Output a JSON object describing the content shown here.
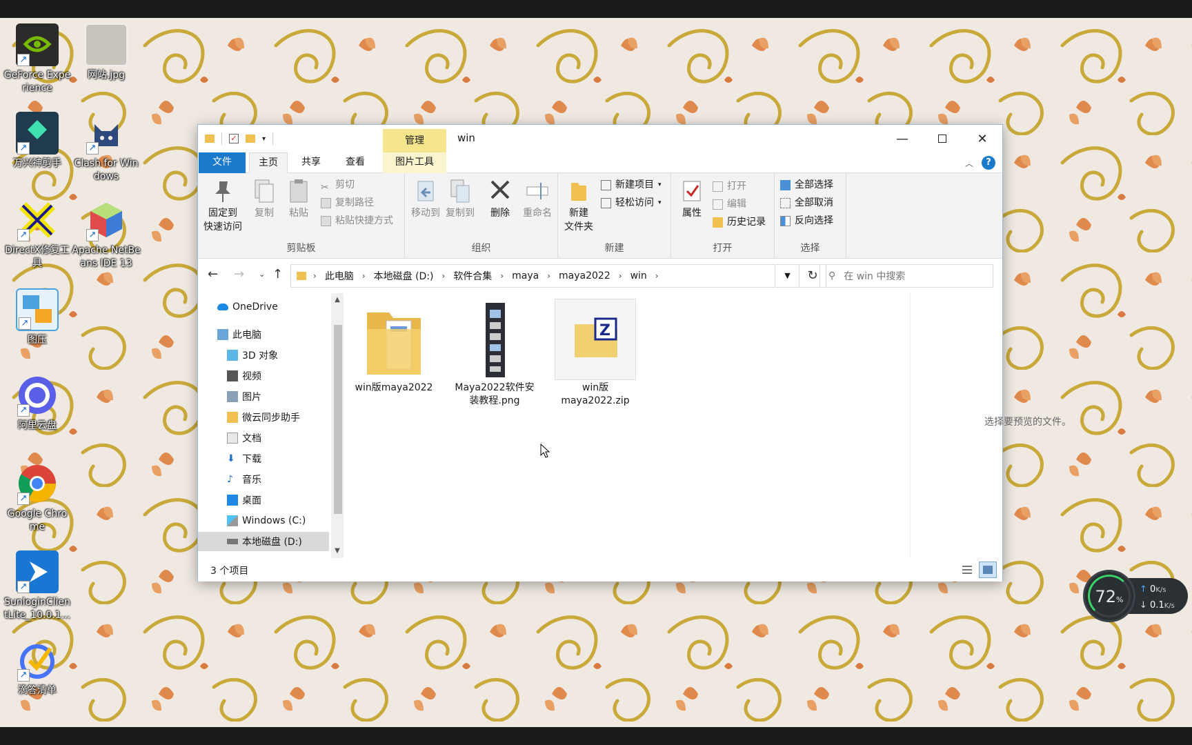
{
  "desktop": {
    "icons": [
      {
        "label": "GeForce Experience",
        "icon": "nvidia-icon",
        "color": "#2b2b2b"
      },
      {
        "label": "网站.jpg",
        "icon": "image-file-icon",
        "color": "#b9b3aa"
      },
      {
        "label": "万兴神剪手",
        "icon": "filmora-icon",
        "color": "#1f3b4d"
      },
      {
        "label": "Clash for Windows",
        "icon": "cat-icon",
        "color": "#2e4a7a"
      },
      {
        "label": "DirectX修复工具",
        "icon": "directx-icon",
        "color": "#1a1a8a"
      },
      {
        "label": "Apache NetBeans IDE 13",
        "icon": "netbeans-cube-icon",
        "color": "#3d7bd6"
      },
      {
        "label": "图压",
        "icon": "image-compress-icon",
        "color": "#4aa3e0"
      },
      {
        "label": "阿里云盘",
        "icon": "aliyun-drive-icon",
        "color": "#5a5fe8"
      },
      {
        "label": "Google Chrome",
        "icon": "chrome-icon",
        "color": "#db4437"
      },
      {
        "label": "SunloginClientLite_10.0.1...",
        "icon": "sunlogin-icon",
        "color": "#1976d2"
      },
      {
        "label": "滴答清单",
        "icon": "ticktick-icon",
        "color": "#4772fa"
      }
    ]
  },
  "window": {
    "title": "win",
    "context_tab": "管理",
    "tabs": [
      "文件",
      "主页",
      "共享",
      "查看",
      "图片工具"
    ],
    "ribbon": {
      "clipboard": {
        "label": "剪贴板",
        "pin": "固定到\n快速访问",
        "copy": "复制",
        "paste": "粘贴",
        "cut": "剪切",
        "copy_path": "复制路径",
        "paste_shortcut": "粘贴快捷方式"
      },
      "organize": {
        "label": "组织",
        "move_to": "移动到",
        "copy_to": "复制到",
        "delete": "删除",
        "rename": "重命名"
      },
      "new": {
        "label": "新建",
        "new_folder": "新建\n文件夹",
        "new_item": "新建项目",
        "easy_access": "轻松访问"
      },
      "open": {
        "label": "打开",
        "properties": "属性",
        "open": "打开",
        "edit": "编辑",
        "history": "历史记录"
      },
      "select": {
        "label": "选择",
        "select_all": "全部选择",
        "select_none": "全部取消",
        "invert": "反向选择"
      }
    },
    "address": {
      "crumbs": [
        "此电脑",
        "本地磁盘 (D:)",
        "软件合集",
        "maya",
        "maya2022",
        "win"
      ],
      "search_placeholder": "在 win 中搜索"
    },
    "nav": [
      {
        "label": "OneDrive",
        "icon": "onedrive-icon",
        "indent": 0
      },
      {
        "label": "此电脑",
        "icon": "this-pc-icon",
        "indent": 0
      },
      {
        "label": "3D 对象",
        "icon": "3d-objects-icon",
        "indent": 1
      },
      {
        "label": "视频",
        "icon": "video-folder-icon",
        "indent": 1
      },
      {
        "label": "图片",
        "icon": "pictures-folder-icon",
        "indent": 1
      },
      {
        "label": "微云同步助手",
        "icon": "weiyun-folder-icon",
        "indent": 1
      },
      {
        "label": "文档",
        "icon": "documents-folder-icon",
        "indent": 1
      },
      {
        "label": "下载",
        "icon": "downloads-folder-icon",
        "indent": 1
      },
      {
        "label": "音乐",
        "icon": "music-folder-icon",
        "indent": 1
      },
      {
        "label": "桌面",
        "icon": "desktop-folder-icon",
        "indent": 1
      },
      {
        "label": "Windows (C:)",
        "icon": "windows-drive-icon",
        "indent": 1
      },
      {
        "label": "本地磁盘 (D:)",
        "icon": "drive-icon",
        "indent": 1,
        "selected": true
      }
    ],
    "files": [
      {
        "name": "win版maya2022",
        "type": "folder",
        "icon": "folder-icon"
      },
      {
        "name": "Maya2022软件安装教程.png",
        "type": "png",
        "icon": "png-thumbnail-icon"
      },
      {
        "name": "win版maya2022.zip",
        "type": "zip",
        "icon": "zip-archive-icon",
        "selected": true
      }
    ],
    "preview_text": "选择要预览的文件。",
    "status": "3 个项目"
  },
  "netmon": {
    "percent": "72",
    "percent_unit": "%",
    "up": "0",
    "down": "0.1",
    "unit": "K/s"
  },
  "colors": {
    "accent": "#1979ca",
    "manage_tab": "#f5e68d",
    "wallpaper": "#efe9e2"
  }
}
